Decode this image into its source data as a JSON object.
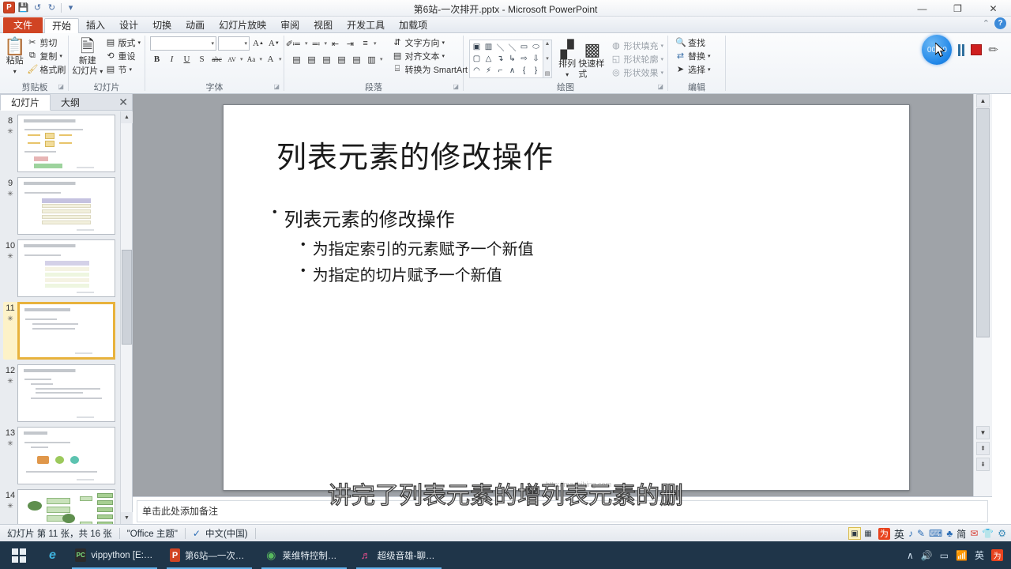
{
  "window": {
    "title": "第6站-一次排开.pptx - Microsoft PowerPoint",
    "app_logo": "P",
    "minimize": "—",
    "maximize": "❐",
    "close": "✕",
    "qat": [
      {
        "name": "save",
        "glyph": "💾"
      },
      {
        "name": "undo",
        "glyph": "↺"
      },
      {
        "name": "redo",
        "glyph": "↻"
      },
      {
        "name": "customize",
        "glyph": "▾"
      }
    ],
    "ribbon_collapse": "⌃",
    "help": "?"
  },
  "tabs": [
    {
      "id": "file",
      "label": "文件"
    },
    {
      "id": "home",
      "label": "开始"
    },
    {
      "id": "insert",
      "label": "插入"
    },
    {
      "id": "design",
      "label": "设计"
    },
    {
      "id": "transitions",
      "label": "切换"
    },
    {
      "id": "animations",
      "label": "动画"
    },
    {
      "id": "slideshow",
      "label": "幻灯片放映"
    },
    {
      "id": "review",
      "label": "审阅"
    },
    {
      "id": "view",
      "label": "视图"
    },
    {
      "id": "developer",
      "label": "开发工具"
    },
    {
      "id": "addins",
      "label": "加载项"
    }
  ],
  "ribbon": {
    "clipboard": {
      "label": "剪贴板",
      "paste": "粘贴",
      "paste_arrow": "▾",
      "cut": "剪切",
      "copy": "复制",
      "copy_arrow": "▾",
      "format_painter": "格式刷"
    },
    "slides": {
      "label": "幻灯片",
      "new_slide_line1": "新建",
      "new_slide_line2": "幻灯片",
      "new_slide_arrow": "▾",
      "layout": "版式",
      "layout_arrow": "▾",
      "reset": "重设",
      "section": "节",
      "section_arrow": "▾"
    },
    "font": {
      "label": "字体",
      "font_name_value": "",
      "font_size_value": "",
      "grow": "A",
      "shrink": "A",
      "clear_format": "✐",
      "bold": "B",
      "italic": "I",
      "underline": "U",
      "shadow": "S",
      "strikethrough": "abc",
      "char_spacing": "AV",
      "change_case": "Aa",
      "font_color": "A"
    },
    "paragraph": {
      "label": "段落",
      "bullets": "≔",
      "numbering": "≕",
      "dec_indent": "⇤",
      "inc_indent": "⇥",
      "line_spacing": "≡",
      "align_left": "▤",
      "align_center": "▤",
      "align_right": "▤",
      "justify": "▤",
      "distribute": "▤",
      "columns": "▥",
      "text_direction": "文字方向",
      "align_text": "对齐文本",
      "smartart": "转换为 SmartArt"
    },
    "drawing": {
      "label": "绘图",
      "shapes": [
        "▣",
        "▥",
        "＼",
        "＼",
        "▭",
        "⬭",
        "▢",
        "△",
        "↴",
        "↳",
        "⇨",
        "⇩",
        "◠",
        "⚡",
        "⌐",
        "∧",
        "{",
        "}"
      ],
      "arrange": "排列",
      "arrange_arrow": "▾",
      "quick_styles": "快速样式",
      "shape_fill": "形状填充",
      "shape_outline": "形状轮廓",
      "shape_effects": "形状效果"
    },
    "editing": {
      "label": "编辑",
      "find": "查找",
      "replace": "替换",
      "select": "选择"
    }
  },
  "recorder": {
    "timer": "00:00",
    "pause_title": "暂停",
    "stop_title": "停止",
    "pen_title": "画笔"
  },
  "side_panel": {
    "tab_slides": "幻灯片",
    "tab_outline": "大纲",
    "close": "✕",
    "thumbnails": [
      {
        "number": "8",
        "selected": false
      },
      {
        "number": "9",
        "selected": false
      },
      {
        "number": "10",
        "selected": false
      },
      {
        "number": "11",
        "selected": true
      },
      {
        "number": "12",
        "selected": false
      },
      {
        "number": "13",
        "selected": false
      },
      {
        "number": "14",
        "selected": false
      }
    ]
  },
  "slide": {
    "title": "列表元素的修改操作",
    "bullet_char": "•",
    "level1": "列表元素的修改操作",
    "level2": [
      "为指定索引的元素赋予一个新值",
      "为指定的切片赋予一个新值"
    ],
    "watermark": "http://mashibing.com"
  },
  "subtitle": "讲完了列表元素的增列表元素的删",
  "notes": {
    "placeholder": "单击此处添加备注"
  },
  "status_bar": {
    "slide_count": "幻灯片 第 11 张，共 16 张",
    "theme": "\"Office 主题\"",
    "spellcheck_glyph": "✓",
    "language": "中文(中国)",
    "view_normal": "▣",
    "view_sorter": "▦",
    "ime": {
      "logo": "为",
      "mode": "英",
      "icons": [
        "♪",
        "✎",
        "⌨",
        "♣",
        "简",
        "✉",
        "👕",
        "⚙"
      ]
    }
  },
  "taskbar": {
    "items": [
      {
        "name": "edge",
        "label": "",
        "glyph": "e",
        "color": "#2aa7d4",
        "open": false
      },
      {
        "name": "pycharm",
        "label": "vippython [E:\\vip...",
        "glyph": "PC",
        "color": "#2b2b2b",
        "open": true
      },
      {
        "name": "powerpoint",
        "label": "第6站—一次排开.p...",
        "glyph": "P",
        "color": "#d04423",
        "open": true
      },
      {
        "name": "leivite",
        "label": "莱维特控制中心",
        "glyph": "◉",
        "color": "#3c8f4c",
        "open": true
      },
      {
        "name": "chaojiyinxiong",
        "label": "超级音雄-聊天1",
        "glyph": "♬",
        "color": "#e8447d",
        "open": true
      }
    ],
    "tray": {
      "chevron": "∧",
      "volume": "🔊",
      "display": "▭",
      "network": "📶",
      "ime_mode": "英",
      "sogou": "为"
    }
  }
}
